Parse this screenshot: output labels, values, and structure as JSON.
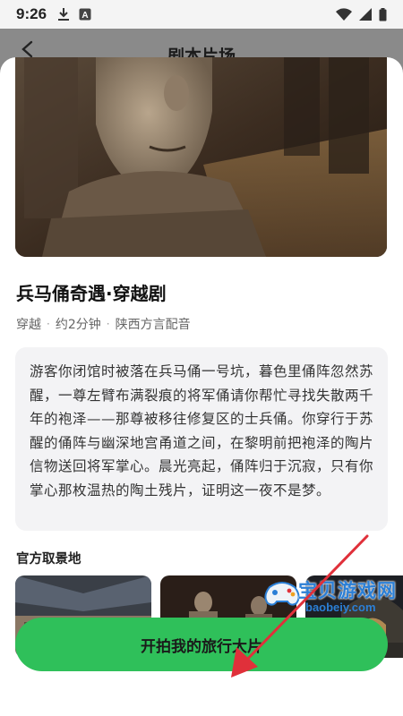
{
  "status_bar": {
    "time": "9:26",
    "left_icons": [
      "download-icon",
      "a-notification-icon"
    ],
    "right_icons": [
      "wifi-icon",
      "signal-icon",
      "battery-icon"
    ]
  },
  "header": {
    "title": "剧本片场",
    "back_icon": "back-arrow-icon"
  },
  "story": {
    "title": "兵马俑奇遇·穿越剧",
    "meta": [
      "穿越",
      "约2分钟",
      "陕西方言配音"
    ],
    "meta_separator": "·",
    "synopsis": "游客你闭馆时被落在兵马俑一号坑，暮色里俑阵忽然苏醒，一尊左臂布满裂痕的将军俑请你帮忙寻找失散两千年的袍泽——那尊被移往修复区的士兵俑。你穿行于苏醒的俑阵与幽深地宫甬道之间，在黎明前把袍泽的陶片信物送回将军掌心。晨光亮起，俑阵归于沉寂，只有你掌心那枚温热的陶土残片，证明这一夜不是梦。"
  },
  "locations": {
    "title": "官方取景地",
    "items": [
      {
        "name": "pit-hall"
      },
      {
        "name": "warrior-statues"
      },
      {
        "name": "tunnel-passage"
      }
    ]
  },
  "watermark": {
    "text": "宝贝游戏网",
    "url": "baobeiy.com"
  },
  "cta": {
    "label": "开拍我的旅行大片"
  },
  "colors": {
    "accent": "#2fc05a",
    "arrow": "#e0303a",
    "watermark": "#2b7fd6"
  }
}
